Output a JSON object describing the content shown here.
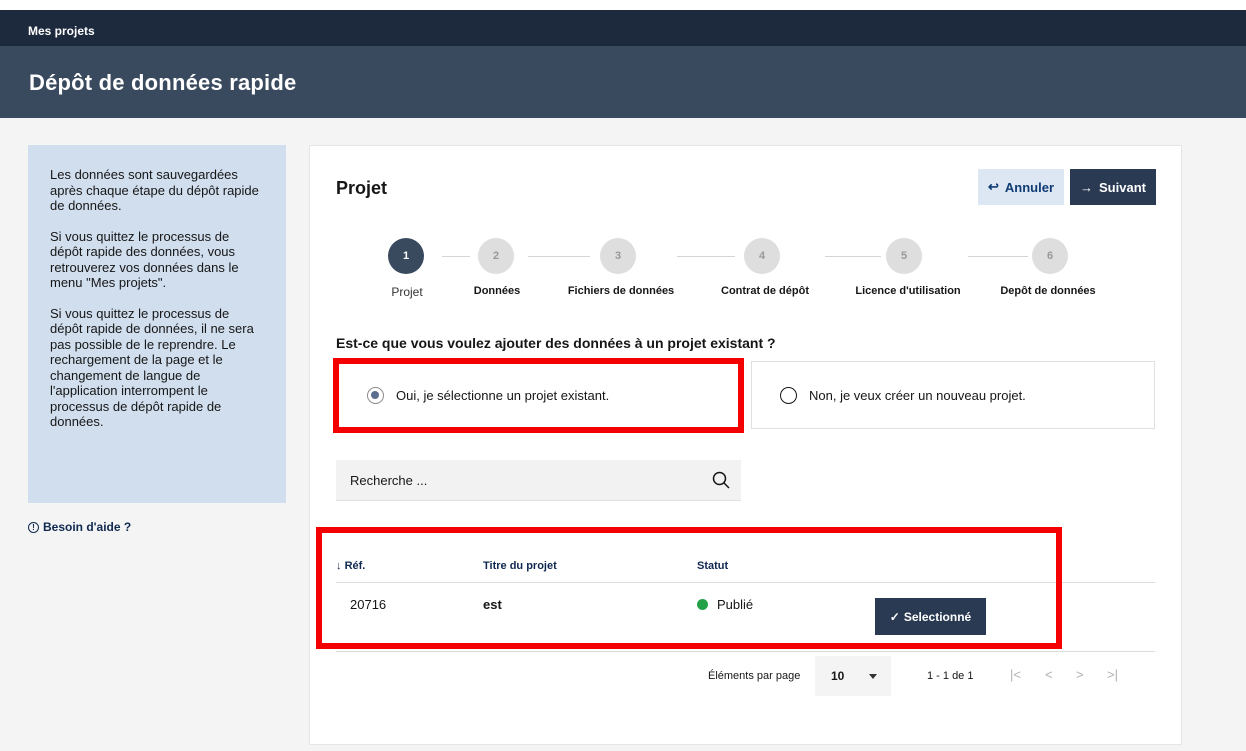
{
  "topbar": {
    "label": "Mes projets"
  },
  "header": {
    "title": "Dépôt de données rapide"
  },
  "sidebar": {
    "paragraphs": [
      "Les données sont sauvegardées après chaque étape du dépôt rapide de données.",
      "Si vous quittez le processus de dépôt rapide des données, vous retrouverez vos données dans le menu \"Mes projets\".",
      "Si vous quittez le processus de dépôt rapide de données, il ne sera pas possible de le reprendre. Le rechargement de la page et le changement de langue de l'application interrompent le processus de dépôt rapide de données."
    ],
    "help_label": "Besoin d'aide ?",
    "help_icon": "info-circle-icon"
  },
  "card": {
    "title": "Projet",
    "cancel_label": "Annuler",
    "cancel_icon": "↩",
    "next_label": "Suivant",
    "next_icon": "→"
  },
  "steps": [
    {
      "number": "1",
      "label": "Projet",
      "active": true
    },
    {
      "number": "2",
      "label": "Données",
      "active": false
    },
    {
      "number": "3",
      "label": "Fichiers de données",
      "active": false
    },
    {
      "number": "4",
      "label": "Contrat de dépôt",
      "active": false
    },
    {
      "number": "5",
      "label": "Licence d'utilisation",
      "active": false
    },
    {
      "number": "6",
      "label": "Depôt de données",
      "active": false
    }
  ],
  "question": "Est-ce que vous voulez ajouter des données à un projet existant ?",
  "options": {
    "yes": {
      "label": "Oui, je sélectionne un projet existant.",
      "selected": true
    },
    "no": {
      "label": "Non, je veux créer un nouveau projet.",
      "selected": false
    }
  },
  "search": {
    "placeholder": "Recherche ..."
  },
  "table": {
    "headers": {
      "ref": "Réf.",
      "title": "Titre du projet",
      "status": "Statut"
    },
    "sort_icon": "↓",
    "rows": [
      {
        "ref": "20716",
        "title": "est",
        "status": "Publié",
        "status_color": "#24a148",
        "action_label": "Selectionné",
        "action_icon": "✓"
      }
    ]
  },
  "pagination": {
    "per_page_label": "Éléments par page",
    "per_page_value": "10",
    "range_label": "1 - 1 de 1"
  },
  "colors": {
    "topbar": "#1d2a3e",
    "header": "#3a4a5e",
    "primary_button": "#2a3a52",
    "highlight": "#f50000",
    "infobox": "#d1deee"
  }
}
